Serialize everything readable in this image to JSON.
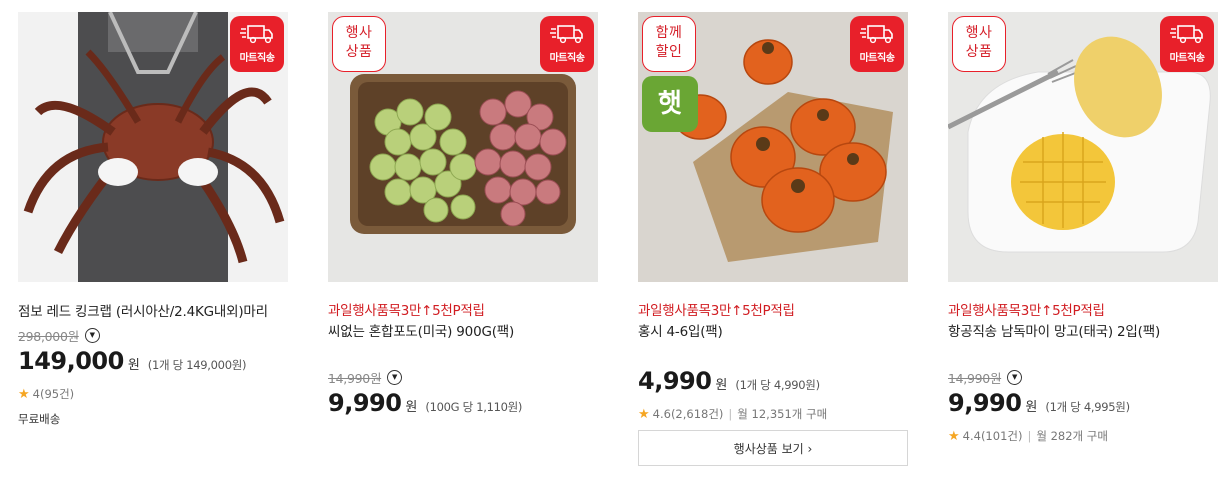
{
  "products": [
    {
      "ship_badge": "마트직송",
      "title": "점보 레드 킹크랩 (러시아산/2.4KG내외)마리",
      "original_price": "298,000원",
      "price": "149,000",
      "won": "원",
      "unit_price": "(1개 당 149,000원)",
      "rating": "4(95건)",
      "shipping": "무료배송"
    },
    {
      "ship_badge": "마트직송",
      "event_badge": "행사\n상품",
      "promo": "과일행사품목3만↑5천P적립",
      "title": "씨없는 혼합포도(미국) 900G(팩)",
      "original_price": "14,990원",
      "price": "9,990",
      "won": "원",
      "unit_price": "(100G 당 1,110원)"
    },
    {
      "ship_badge": "마트직송",
      "event_badge": "함께\n할인",
      "fresh_badge": "햇",
      "promo": "과일행사품목3만↑5천P적립",
      "title": "홍시 4-6입(팩)",
      "price": "4,990",
      "won": "원",
      "unit_price": "(1개 당 4,990원)",
      "rating": "4.6(2,618건)",
      "monthly": "월 12,351개 구매",
      "event_button": "행사상품 보기 ›"
    },
    {
      "ship_badge": "마트직송",
      "event_badge": "행사\n상품",
      "promo": "과일행사품목3만↑5천P적립",
      "title": "항공직송 남독마이 망고(태국) 2입(팩)",
      "original_price": "14,990원",
      "price": "9,990",
      "won": "원",
      "unit_price": "(1개 당 4,995원)",
      "rating": "4.4(101건)",
      "monthly": "월 282개 구매"
    }
  ],
  "colors": {
    "accent_red": "#e8202a",
    "fresh_green": "#6aa634",
    "star": "#f5a623"
  },
  "icons": {
    "ship": "delivery-truck-icon",
    "info": "chevron-down-circle-icon",
    "star": "star-icon"
  }
}
